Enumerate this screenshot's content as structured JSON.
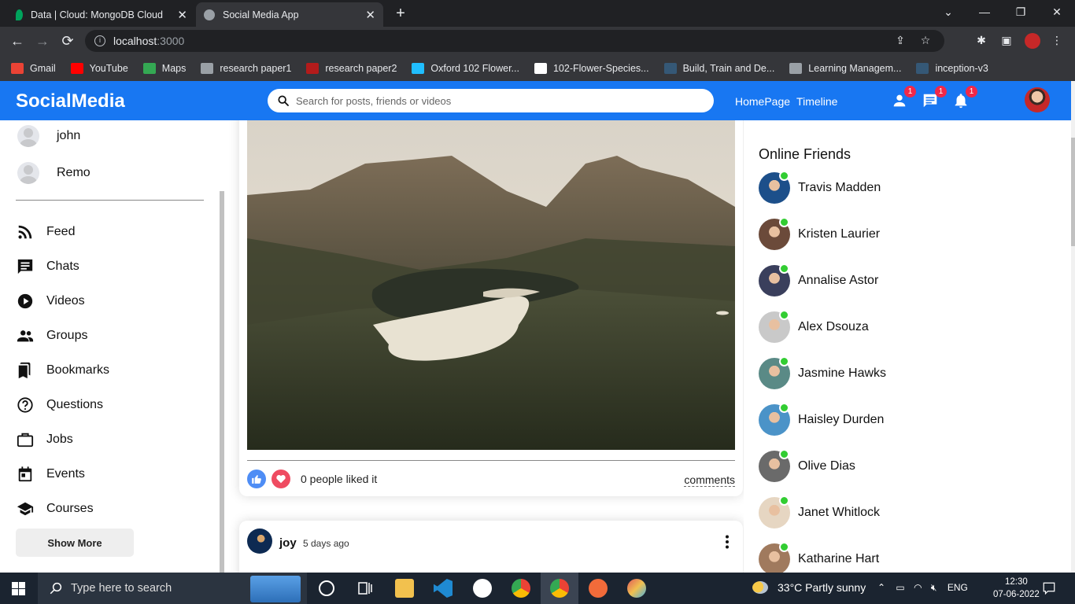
{
  "browser": {
    "tabs": [
      {
        "title": "Data | Cloud: MongoDB Cloud",
        "active": false
      },
      {
        "title": "Social Media App",
        "active": true
      }
    ],
    "url_host": "localhost",
    "url_port": ":3000",
    "bookmarks": [
      {
        "label": "Gmail",
        "icon": "gmail-icon",
        "color": "#ea4335"
      },
      {
        "label": "YouTube",
        "icon": "youtube-icon",
        "color": "#ff0000"
      },
      {
        "label": "Maps",
        "icon": "maps-icon",
        "color": "#34a853"
      },
      {
        "label": "research paper1",
        "icon": "globe-icon",
        "color": "#9aa0a6"
      },
      {
        "label": "research paper2",
        "icon": "dash-icon",
        "color": "#b31b1b"
      },
      {
        "label": "Oxford 102 Flower...",
        "icon": "kaggle-icon",
        "color": "#20beff"
      },
      {
        "label": "102-Flower-Species...",
        "icon": "github-icon",
        "color": "#ffffff"
      },
      {
        "label": "Build, Train and De...",
        "icon": "tds-icon",
        "color": "#355876"
      },
      {
        "label": "Learning Managem...",
        "icon": "globe-icon",
        "color": "#9aa0a6"
      },
      {
        "label": "inception-v3",
        "icon": "tds-icon",
        "color": "#355876"
      }
    ]
  },
  "header": {
    "logo": "SocialMedia",
    "search_placeholder": "Search for posts, friends or videos",
    "links": [
      "HomePage",
      "Timeline"
    ],
    "badges": {
      "friends": "1",
      "messages": "1",
      "notifications": "1"
    },
    "accent": "#1877f2"
  },
  "sidebar": {
    "friends": [
      "john",
      "Remo"
    ],
    "menu": [
      {
        "label": "Feed",
        "icon": "rss-icon"
      },
      {
        "label": "Chats",
        "icon": "chat-icon"
      },
      {
        "label": "Videos",
        "icon": "play-circle-icon"
      },
      {
        "label": "Groups",
        "icon": "group-icon"
      },
      {
        "label": "Bookmarks",
        "icon": "bookmarks-icon"
      },
      {
        "label": "Questions",
        "icon": "help-circle-icon"
      },
      {
        "label": "Jobs",
        "icon": "briefcase-icon"
      },
      {
        "label": "Events",
        "icon": "calendar-icon"
      },
      {
        "label": "Courses",
        "icon": "school-icon"
      }
    ],
    "show_more": "Show More"
  },
  "feed": {
    "post1": {
      "likes_text": "0 people liked it",
      "comments_label": "comments"
    },
    "post2": {
      "author": "joy",
      "time": "5 days ago"
    }
  },
  "rightbar": {
    "title": "Online Friends",
    "friends": [
      {
        "name": "Travis Madden",
        "color": "#1c4f8a"
      },
      {
        "name": "Kristen Laurier",
        "color": "#6b4a3a"
      },
      {
        "name": "Annalise Astor",
        "color": "#3a3f5c"
      },
      {
        "name": "Alex Dsouza",
        "color": "#c9c9c9"
      },
      {
        "name": "Jasmine Hawks",
        "color": "#5a8a86"
      },
      {
        "name": "Haisley Durden",
        "color": "#4b93c8"
      },
      {
        "name": "Olive Dias",
        "color": "#6a6a6a"
      },
      {
        "name": "Janet Whitlock",
        "color": "#e6d6c2"
      },
      {
        "name": "Katharine Hart",
        "color": "#a07a5e"
      }
    ],
    "online_color": "#32cd32"
  },
  "taskbar": {
    "search_placeholder": "Type here to search",
    "weather": "33°C  Partly sunny",
    "lang": "ENG",
    "time": "12:30",
    "date": "07-06-2022"
  }
}
